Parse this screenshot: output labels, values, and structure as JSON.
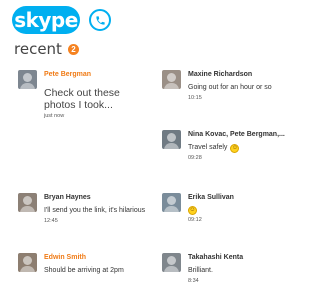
{
  "app": {
    "logo_text": "skype"
  },
  "recent": {
    "title": "recent",
    "badge_count": "2"
  },
  "conversations": [
    {
      "name": "Pete Bergman",
      "message": "Check out these photos I took...",
      "time": "just now",
      "highlight": true
    },
    {
      "name": "Maxine Richardson",
      "message": "Going out for an hour or so",
      "time": "10:15",
      "highlight": false
    },
    {
      "name": "Nina Kovac, Pete Bergman,...",
      "message": "Travel safely",
      "time": "09:28",
      "highlight": false
    },
    {
      "name": "Bryan Haynes",
      "message": "I'll send you the link, it's hilarious",
      "time": "12:45",
      "highlight": false
    },
    {
      "name": "Erika Sullivan",
      "message": "",
      "time": "09:12",
      "highlight": false
    },
    {
      "name": "Edwin Smith",
      "message": "Should be arriving at 2pm",
      "time": "",
      "highlight": true
    },
    {
      "name": "Takahashi Kenta",
      "message": "Brilliant.",
      "time": "8:34",
      "highlight": false
    }
  ],
  "colors": {
    "brand": "#00aff0",
    "accent": "#f07b16",
    "badge": "#f58220"
  },
  "icons": {
    "call": "phone-icon",
    "emoji": "smiley-emoji-icon"
  }
}
